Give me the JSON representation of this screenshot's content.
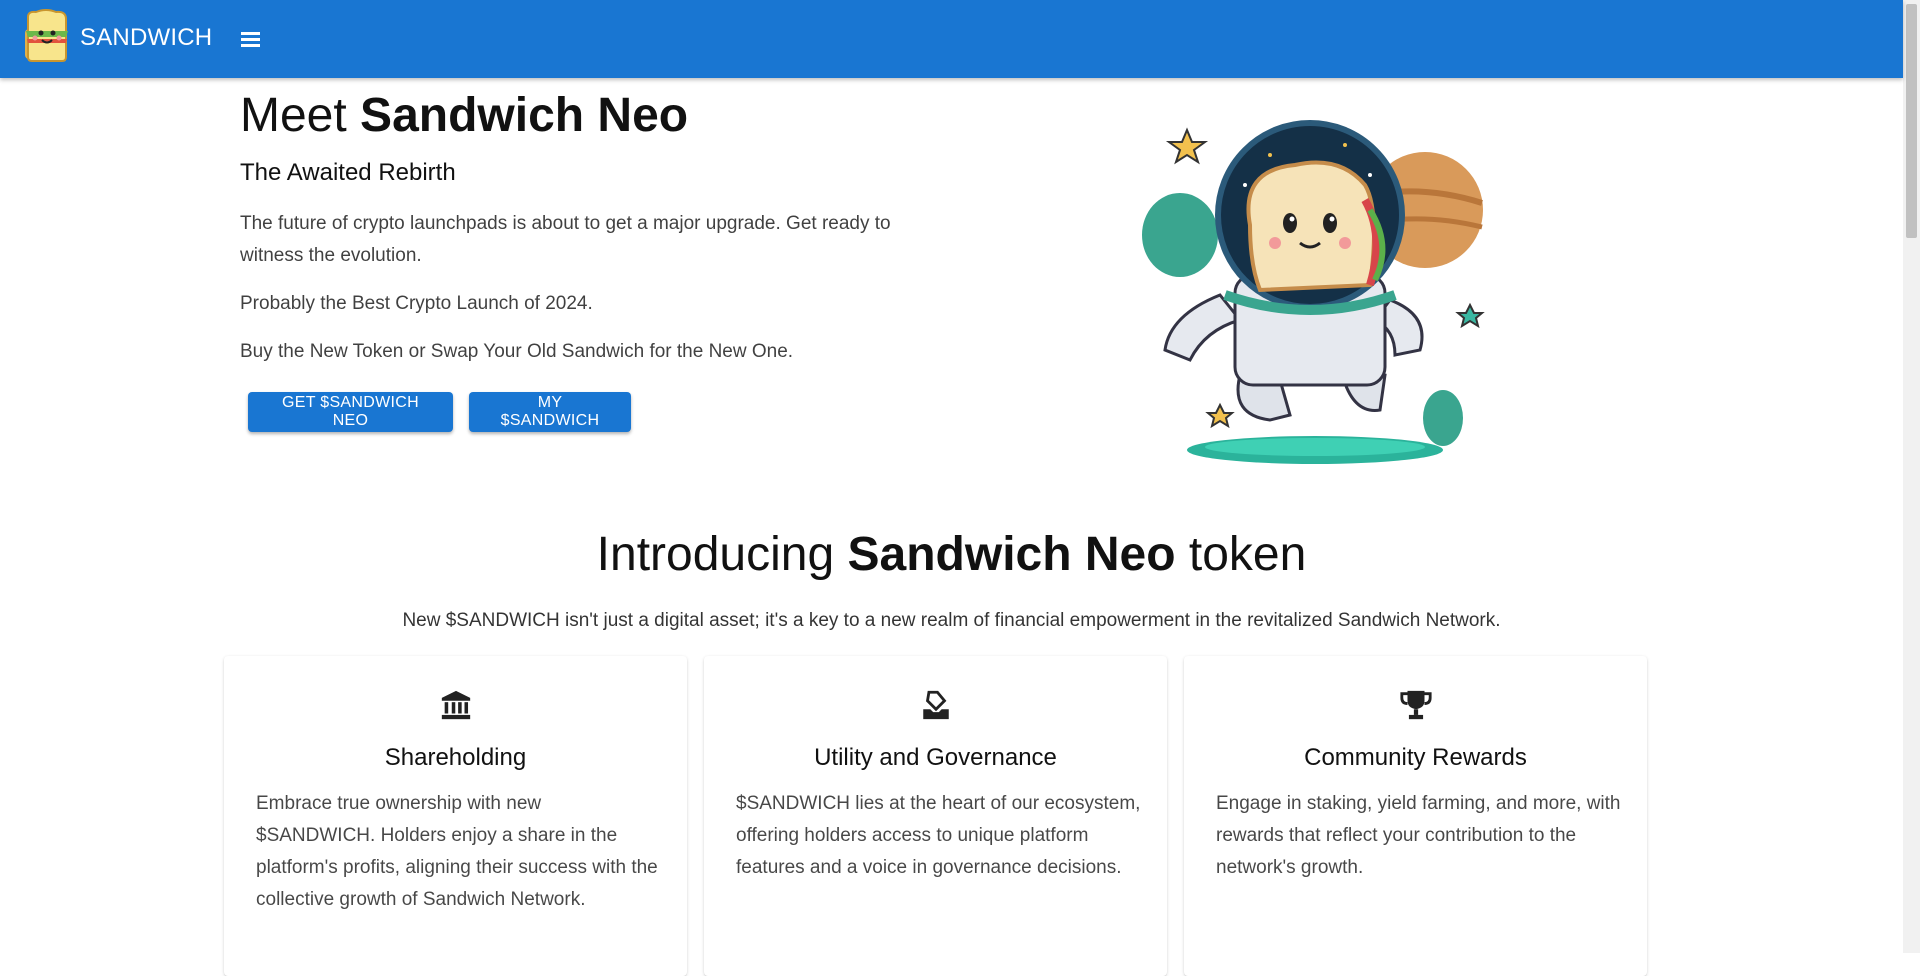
{
  "app": {
    "brand": "SANDWICH"
  },
  "hero": {
    "title_prefix": "Meet ",
    "title_bold": "Sandwich Neo",
    "subtitle": "The Awaited Rebirth",
    "paragraph1": "The future of crypto launchpads is about to get a major upgrade. Get ready to witness the evolution.",
    "paragraph2": "Probably the Best Crypto Launch of 2024.",
    "paragraph3": "Buy the New Token or Swap Your Old Sandwich for the New One.",
    "button_get": "GET $SANDWICH NEO",
    "button_my": "MY $SANDWICH"
  },
  "intro": {
    "title_prefix": "Introducing ",
    "title_bold": "Sandwich Neo",
    "title_suffix": " token",
    "description": "New $SANDWICH isn't just a digital asset; it's a key to a new realm of financial empowerment in the revitalized Sandwich Network."
  },
  "cards": [
    {
      "icon": "bank-icon",
      "title": "Shareholding",
      "text": "Embrace true ownership with new $SANDWICH. Holders enjoy a share in the platform's profits, aligning their success with the collective growth of Sandwich Network."
    },
    {
      "icon": "vote-icon",
      "title": "Utility and Governance",
      "text": "$SANDWICH lies at the heart of our ecosystem, offering holders access to unique platform features and a voice in governance decisions."
    },
    {
      "icon": "trophy-icon",
      "title": "Community Rewards",
      "text": "Engage in staking, yield farming, and more, with rewards that reflect your contribution to the network's growth."
    }
  ],
  "colors": {
    "primary": "#1976d2",
    "background": "#ffffff"
  }
}
